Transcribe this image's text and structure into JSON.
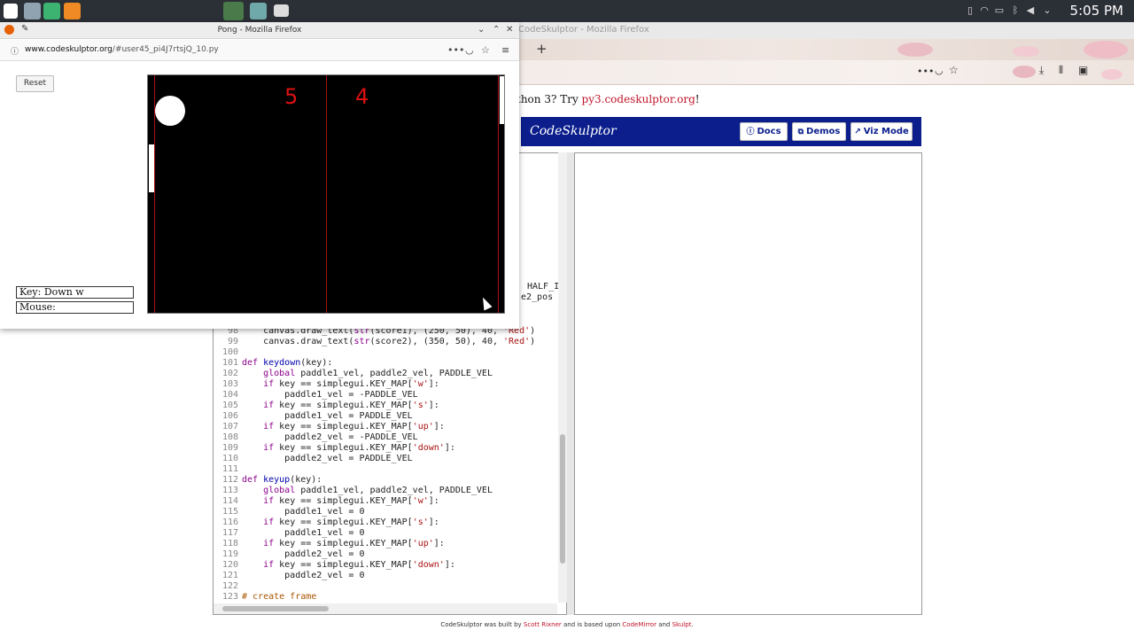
{
  "taskbar": {
    "clock": "5:05 PM"
  },
  "bg_window": {
    "title": "CodeSkulptor - Mozilla Firefox",
    "py3_prefix": "thon 3? Try ",
    "py3_link": "py3.codeskulptor.org",
    "py3_suffix": "!",
    "logo": "CodeSkulptor",
    "buttons": {
      "docs": "Docs",
      "demos": "Demos",
      "viz": "Viz Mode"
    },
    "overflow_code": [
      "HALF_I",
      "e2_pos"
    ],
    "footer": {
      "p1": "CodeSkulptor was built by ",
      "author": "Scott Rixner",
      "p2": " and is based upon ",
      "lib1": "CodeMirror",
      "p3": " and ",
      "lib2": "Skulpt",
      "p4": "."
    }
  },
  "code": {
    "lines": [
      {
        "n": "98",
        "t": "    canvas.draw_text(str(score1), (250, 50), 40, 'Red')"
      },
      {
        "n": "99",
        "t": "    canvas.draw_text(str(score2), (350, 50), 40, 'Red')"
      },
      {
        "n": "100",
        "t": ""
      },
      {
        "n": "101",
        "t": "def keydown(key):"
      },
      {
        "n": "102",
        "t": "    global paddle1_vel, paddle2_vel, PADDLE_VEL"
      },
      {
        "n": "103",
        "t": "    if key == simplegui.KEY_MAP['w']:"
      },
      {
        "n": "104",
        "t": "        paddle1_vel = -PADDLE_VEL"
      },
      {
        "n": "105",
        "t": "    if key == simplegui.KEY_MAP['s']:"
      },
      {
        "n": "106",
        "t": "        paddle1_vel = PADDLE_VEL"
      },
      {
        "n": "107",
        "t": "    if key == simplegui.KEY_MAP['up']:"
      },
      {
        "n": "108",
        "t": "        paddle2_vel = -PADDLE_VEL"
      },
      {
        "n": "109",
        "t": "    if key == simplegui.KEY_MAP['down']:"
      },
      {
        "n": "110",
        "t": "        paddle2_vel = PADDLE_VEL"
      },
      {
        "n": "111",
        "t": ""
      },
      {
        "n": "112",
        "t": "def keyup(key):"
      },
      {
        "n": "113",
        "t": "    global paddle1_vel, paddle2_vel, PADDLE_VEL"
      },
      {
        "n": "114",
        "t": "    if key == simplegui.KEY_MAP['w']:"
      },
      {
        "n": "115",
        "t": "        paddle1_vel = 0"
      },
      {
        "n": "116",
        "t": "    if key == simplegui.KEY_MAP['s']:"
      },
      {
        "n": "117",
        "t": "        paddle1_vel = 0"
      },
      {
        "n": "118",
        "t": "    if key == simplegui.KEY_MAP['up']:"
      },
      {
        "n": "119",
        "t": "        paddle2_vel = 0"
      },
      {
        "n": "120",
        "t": "    if key == simplegui.KEY_MAP['down']:"
      },
      {
        "n": "121",
        "t": "        paddle2_vel = 0"
      },
      {
        "n": "122",
        "t": ""
      },
      {
        "n": "123",
        "t": "# create frame"
      }
    ]
  },
  "pong_window": {
    "title": "Pong - Mozilla Firefox",
    "url_host": "www.codeskulptor.org",
    "url_path": "/#user45_pi4J7rtsjQ_10.py",
    "reset_label": "Reset",
    "key_status": "Key: Down w",
    "mouse_status": "Mouse:",
    "score_left": "5",
    "score_right": "4"
  },
  "colors": {
    "codeskulptor_blue": "#0b1e8c",
    "score_red": "#dd1111",
    "link_red": "#c0152a"
  }
}
